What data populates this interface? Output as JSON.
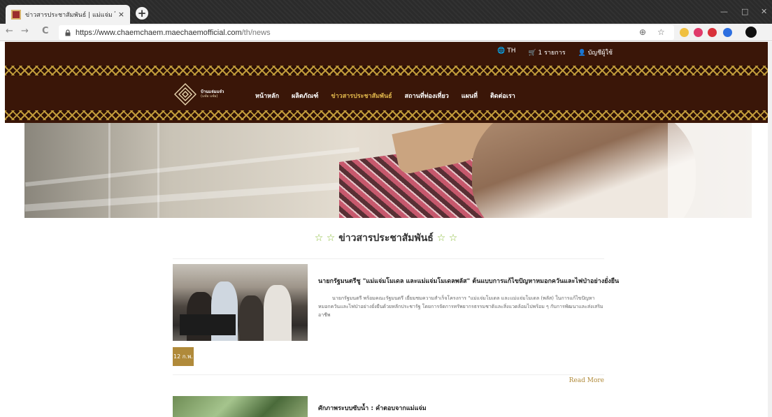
{
  "browser": {
    "tab_title": "ข่าวสารประชาสัมพันธ์ | แม่แจ่ม โครงการ",
    "tab_close": "×",
    "new_tab": "+",
    "back": "←",
    "forward": "→",
    "reload": "C",
    "url_host": "https://www.chaemchaem.maechaemofficial.com",
    "url_path": "/th/news",
    "zoom_icon": "⊕",
    "star_icon": "☆",
    "window_min": "—",
    "window_max": "□",
    "window_close": "✕"
  },
  "header": {
    "language": "TH",
    "cart": "1 รายการ",
    "account": "บัญชีผู้ใช้",
    "logo_name": "บ้านแจ่มแจ๋ว",
    "logo_sub": "(แจ๋ม แจ๋ม)",
    "nav": [
      {
        "label": "หน้าหลัก"
      },
      {
        "label": "ผลิตภัณฑ์"
      },
      {
        "label": "ข่าวสารประชาสัมพันธ์"
      },
      {
        "label": "สถานที่ท่องเที่ยว"
      },
      {
        "label": "แผนที่"
      },
      {
        "label": "ติดต่อเรา"
      }
    ],
    "colors": {
      "bg": "#3a1608",
      "active": "#e0b64b",
      "pattern": "#c09a3a"
    }
  },
  "main": {
    "section_title": "ข่าวสารประชาสัมพันธ์",
    "star_left": "☆ ☆",
    "star_right": "☆ ☆",
    "news": [
      {
        "title": "นายกรัฐมนตรีชู \"แม่แจ่มโมเดล และแม่แจ่มโมเดลพลัส\" ต้นแบบการแก้ไขปัญหาหมอกควันและไฟป่าอย่างยั่งยืน",
        "excerpt": "นายกรัฐมนตรี พร้อมคณะรัฐมนตรี เยี่ยมชมความสำเร็จโครงการ \"แม่แจ่มโมเดล และแม่แจ่มโมเดล (พลัส) ในการแก้ไขปัญหาหมอกควันและไฟป่าอย่างยั่งยืนด้วยหลักประชารัฐ โดยการจัดการทรัพยากรธรรมชาติและสิ่งแวดล้อมไปพร้อม ๆ กับการพัฒนาและส่งเสริมอาชีพ",
        "date": "12 ก.พ.",
        "read_more": "Read More"
      },
      {
        "title": "ศักภาพระบบซับน้ำ : คำตอบจากแม่แจ่ม"
      }
    ],
    "accent": "#b08a3a"
  }
}
